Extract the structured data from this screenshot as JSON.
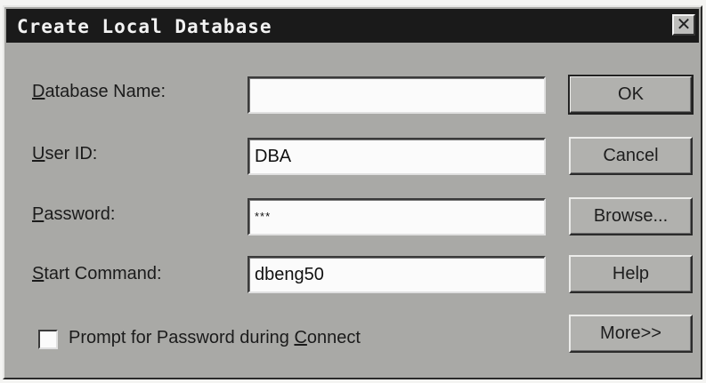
{
  "dialog": {
    "title": "Create Local Database",
    "close_glyph": "✕"
  },
  "fields": {
    "database_name": {
      "label_mnemonic": "D",
      "label_rest": "atabase Name:",
      "value": ""
    },
    "user_id": {
      "label_mnemonic": "U",
      "label_rest": "ser ID:",
      "value": "DBA"
    },
    "password": {
      "label_mnemonic": "P",
      "label_rest": "assword:",
      "value": "***"
    },
    "start_command": {
      "label_mnemonic": "S",
      "label_rest": "tart Command:",
      "value": "dbeng50"
    }
  },
  "buttons": {
    "ok": "OK",
    "cancel": "Cancel",
    "browse": "Browse...",
    "help": "Help",
    "more": "More>>"
  },
  "prompt_checkbox": {
    "label_before": "Prompt for Password during ",
    "label_mnemonic": "C",
    "label_after": "onnect",
    "checked": false
  }
}
